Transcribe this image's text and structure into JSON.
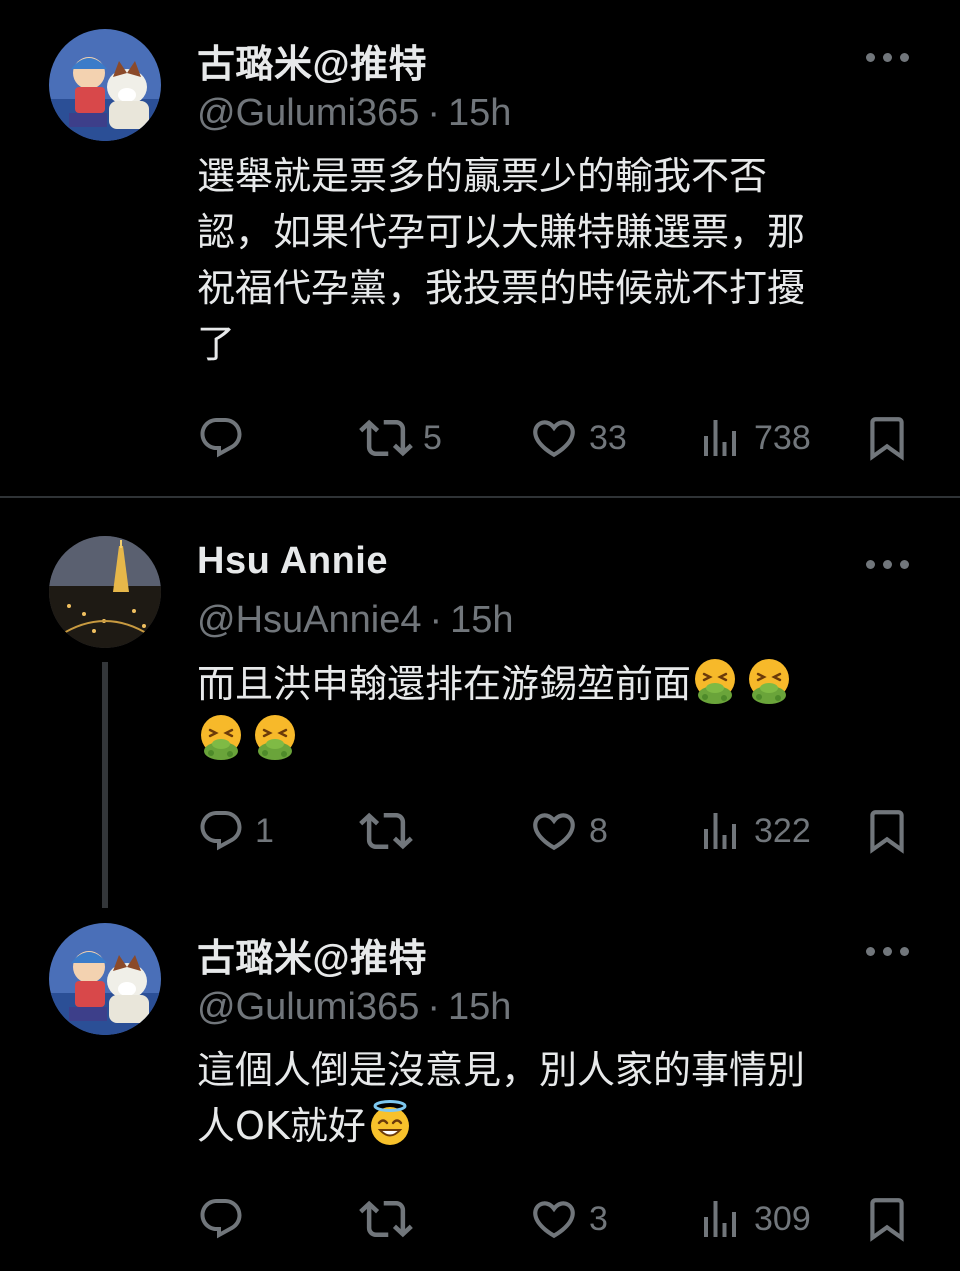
{
  "tweets": [
    {
      "name": "古璐米@推特",
      "handle": "@Gulumi365",
      "time": "15h",
      "text_lines": [
        "選舉就是票多的贏票少的輸我不否",
        "認，如果代孕可以大賺特賺選票，那",
        "祝福代孕黨，我投票的時候就不打擾",
        "了"
      ],
      "replies": "",
      "retweets": "5",
      "likes": "33",
      "views": "738"
    },
    {
      "name": "Hsu Annie",
      "handle": "@HsuAnnie4",
      "time": "15h",
      "text_lines": [
        "而且洪申翰還排在游錫堃前面"
      ],
      "replies": "1",
      "retweets": "",
      "likes": "8",
      "views": "322"
    },
    {
      "name": "古璐米@推特",
      "handle": "@Gulumi365",
      "time": "15h",
      "text_lines": [
        "這個人倒是沒意見，別人家的事情別",
        "人OK就好"
      ],
      "replies": "",
      "retweets": "",
      "likes": "3",
      "views": "309"
    }
  ],
  "separator": "·",
  "icons": {
    "reply": "reply-icon",
    "retweet": "retweet-icon",
    "like": "heart-icon",
    "views": "views-chart-icon",
    "bookmark": "bookmark-icon",
    "more": "more-dots-icon",
    "vomit": "face-vomiting-emoji",
    "halo": "smiling-face-with-halo-emoji"
  },
  "colors": {
    "background": "#000000",
    "text": "#e7e9ea",
    "muted": "#71767b",
    "divider": "#2f3336"
  }
}
